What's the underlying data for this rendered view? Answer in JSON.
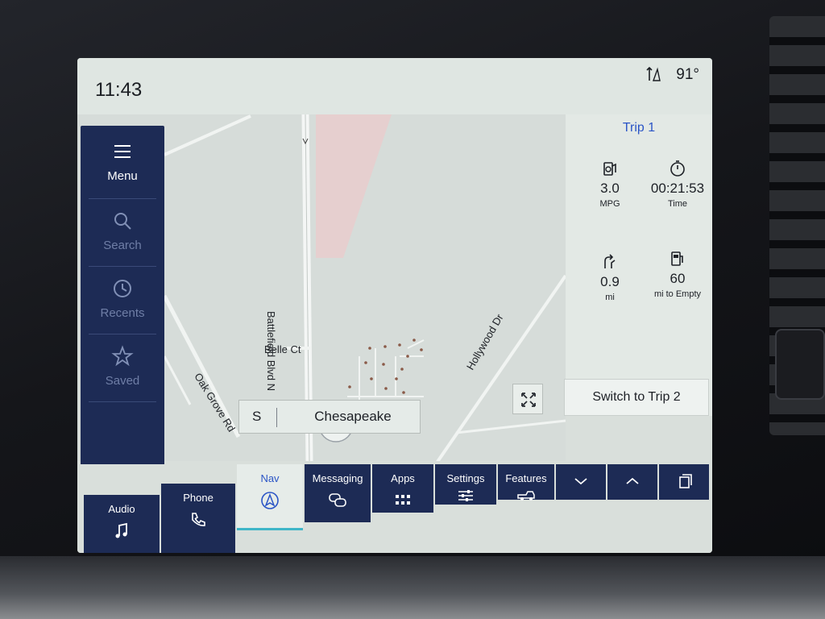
{
  "status": {
    "time": "11:43",
    "temperature": "91°"
  },
  "sidebar": {
    "items": [
      {
        "label": "Menu",
        "icon": "menu-icon"
      },
      {
        "label": "Search",
        "icon": "search-icon"
      },
      {
        "label": "Recents",
        "icon": "recents-icon"
      },
      {
        "label": "Saved",
        "icon": "star-icon"
      }
    ]
  },
  "map": {
    "streets": [
      "Belle Ct",
      "Battlefield Blvd N",
      "Oak Grove Rd",
      "Hollywood Dr"
    ],
    "search_prefix": "S",
    "destination": "Chesapeake"
  },
  "trip": {
    "title": "Trip 1",
    "metrics": [
      {
        "value": "3.0",
        "unit": "MPG",
        "icon": "fuel-economy-icon"
      },
      {
        "value": "00:21:53",
        "unit": "Time",
        "icon": "stopwatch-icon"
      },
      {
        "value": "0.9",
        "unit": "mi",
        "icon": "distance-icon"
      },
      {
        "value": "60",
        "unit": "mi to Empty",
        "icon": "fuel-pump-icon"
      }
    ],
    "switch_label": "Switch to Trip 2"
  },
  "tabs": [
    {
      "label": "Audio",
      "icon": "music-note-icon"
    },
    {
      "label": "Phone",
      "icon": "phone-icon"
    },
    {
      "label": "Nav",
      "icon": "navigation-icon"
    },
    {
      "label": "Messaging",
      "icon": "chat-icon"
    },
    {
      "label": "Apps",
      "icon": "grid-icon"
    },
    {
      "label": "Settings",
      "icon": "sliders-icon"
    },
    {
      "label": "Features",
      "icon": "truck-icon"
    }
  ],
  "colors": {
    "nav_blue": "#1d2b55",
    "accent_blue": "#2b55c6",
    "active_underline": "#3fb6c8"
  }
}
